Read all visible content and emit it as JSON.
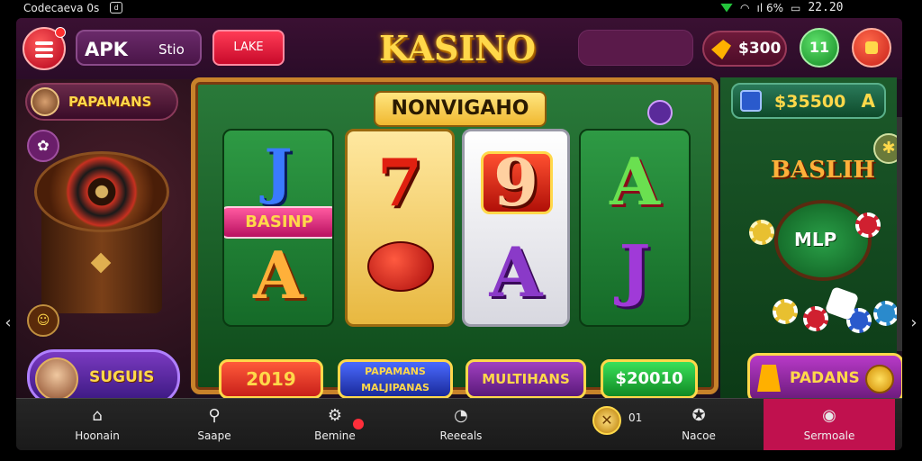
{
  "status_bar": {
    "left_text": "Codecaeva 0s",
    "right_text": "ıl 6%",
    "time": "22.20"
  },
  "header": {
    "apk_title": "APK",
    "apk_sub": "Stio",
    "red_button": "LAKE",
    "logo": "KASINO",
    "coins": "$300",
    "green_round": "11"
  },
  "left": {
    "promo_label": "PAPAMANS",
    "spin_label": "SUGUIS"
  },
  "board": {
    "title": "NONVIGAHO",
    "reel1_top": "J",
    "reel1_label": "BASINP",
    "reel1_bottom": "A",
    "reel2_top": "7",
    "reel3_top": "9",
    "reel3_bottom": "A",
    "reel4_top": "A",
    "reel4_bottom": "J",
    "btn_bet": "2019",
    "btn_bonus_line1": "PAPAMANS",
    "btn_bonus_line2": "MALJIPANAS",
    "btn_multi": "MULTIHANS",
    "btn_win": "$20010"
  },
  "right": {
    "balance": "$35500",
    "balance_suffix": "A",
    "bash_label": "BASLIH",
    "table_label": "MLP",
    "pad_label": "PADANS"
  },
  "nav": {
    "items": [
      {
        "label": "Hoonain",
        "icon": "home-icon"
      },
      {
        "label": "Saape",
        "icon": "search-icon"
      },
      {
        "label": "Bemine",
        "icon": "gear-icon"
      },
      {
        "label": "Reeeals",
        "icon": "user-icon"
      },
      {
        "label": "01",
        "icon": "coin-icon"
      },
      {
        "label": "Nacoe",
        "icon": "chat-icon"
      },
      {
        "label": "Sermoale",
        "icon": "refresh-icon"
      }
    ]
  },
  "colors": {
    "accent": "#c0114e",
    "gold": "#ffd84a",
    "felt": "#1c5a2a"
  }
}
